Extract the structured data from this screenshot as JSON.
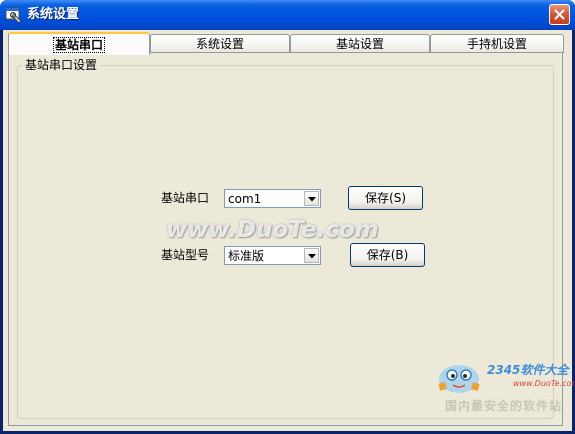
{
  "window": {
    "title": "系统设置",
    "icon": "settings-app-icon",
    "close_icon": "close-icon"
  },
  "tabs": [
    {
      "label": "基站串口",
      "active": true
    },
    {
      "label": "系统设置",
      "active": false
    },
    {
      "label": "基站设置",
      "active": false
    },
    {
      "label": "手持机设置",
      "active": false
    }
  ],
  "group": {
    "title": "基站串口设置"
  },
  "form": {
    "port_label": "基站串口",
    "port_value": "com1",
    "port_save_label": "保存",
    "port_save_mnemonic": "(S)",
    "model_label": "基站型号",
    "model_value": "标准版",
    "model_save_label": "保存",
    "model_save_mnemonic": "(B)"
  },
  "watermark": {
    "text": "www.DuoTe.com"
  },
  "logo": {
    "brand": "2345软件大全",
    "url": "www.DuoTe.com",
    "slogan": "国内最安全的软件站"
  },
  "colors": {
    "titlebar": "#0054e3",
    "client": "#ece9d8",
    "close_button": "#d65a35",
    "active_tab_highlight": "#ffc83c"
  }
}
